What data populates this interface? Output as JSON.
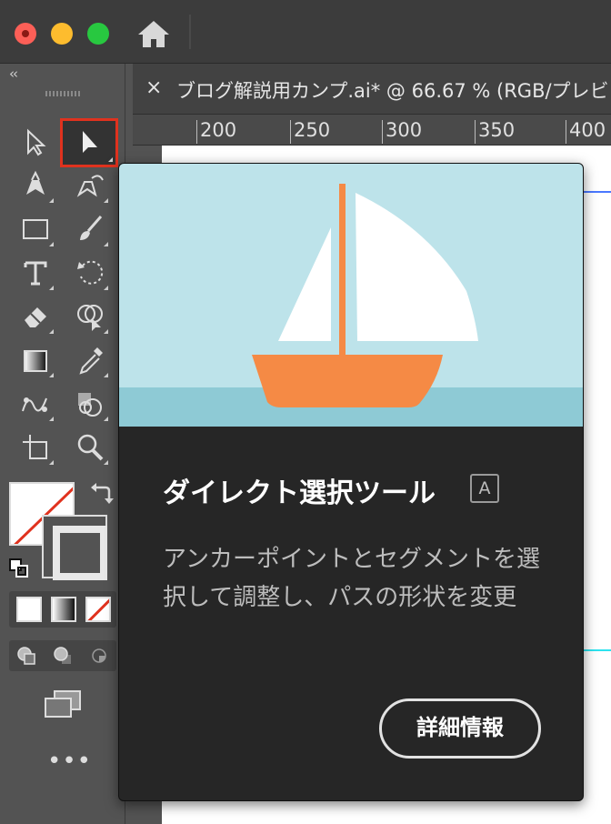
{
  "window": {
    "traffic_lights": [
      "close",
      "minimize",
      "maximize"
    ],
    "home_icon": "home-icon"
  },
  "document": {
    "close_label": "×",
    "tab_title": "ブログ解説用カンプ.ai* @ 66.67 % (RGB/プレビ"
  },
  "ruler": {
    "ticks": [
      "200",
      "250",
      "300",
      "350",
      "400"
    ]
  },
  "toolbar": {
    "collapse_label": "‹‹",
    "tools": [
      "selection-tool",
      "direct-selection-tool",
      "pen-tool",
      "curvature-tool",
      "rectangle-tool",
      "paintbrush-tool",
      "type-tool",
      "rotate-tool",
      "eraser-tool",
      "shape-builder-tool",
      "gradient-tool",
      "eyedropper-tool",
      "blend-tool",
      "live-paint-tool",
      "artboard-tool",
      "zoom-tool"
    ],
    "more_label": "•••"
  },
  "tooltip": {
    "title": "ダイレクト選択ツール",
    "shortcut": "A",
    "description": "アンカーポイントとセグメントを選択して調整し、パスの形状を変更",
    "more_button": "詳細情報"
  },
  "colors": {
    "accent_red": "#e0321e",
    "sky": "#bde3ea",
    "sea": "#8ecad5",
    "hull": "#f58a45",
    "mast": "#f58a45",
    "sail": "#ffffff"
  }
}
